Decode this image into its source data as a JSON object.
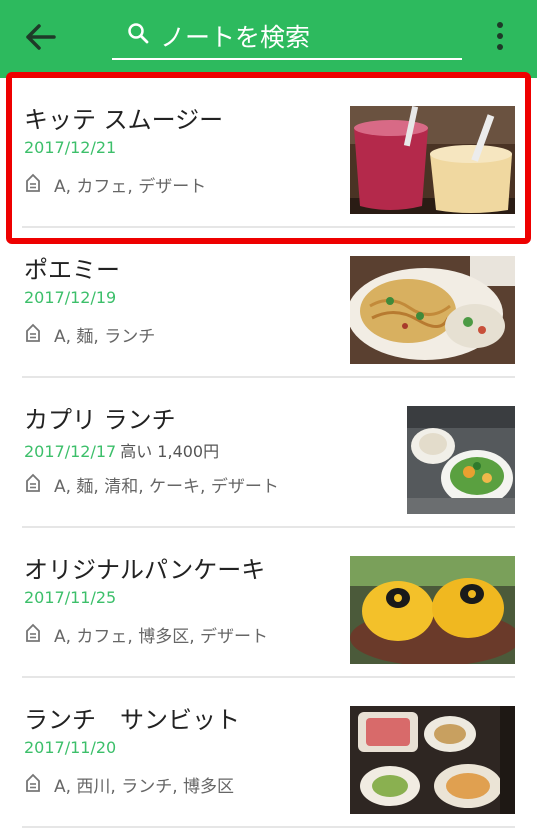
{
  "appbar": {
    "back_icon": "arrow-left-icon",
    "search": {
      "icon": "search-icon",
      "placeholder": "ノートを検索"
    },
    "more_icon": "more-vertical-icon"
  },
  "notes": [
    {
      "title": "キッテ スムージー",
      "date": "2017/12/21",
      "extra": "",
      "tags": "A, カフェ, デザート",
      "tag_icon": "tag-icon",
      "thumbnail": "smoothie-photo"
    },
    {
      "title": "ポエミー",
      "date": "2017/12/19",
      "extra": "",
      "tags": "A, 麺, ランチ",
      "tag_icon": "tag-icon",
      "thumbnail": "pasta-photo"
    },
    {
      "title": "カプリ ランチ",
      "date": "2017/12/17",
      "extra": "高い 1,400円",
      "tags": "A, 麺, 清和, ケーキ, デザート",
      "tag_icon": "tag-icon",
      "thumbnail": "lunch-salad-photo"
    },
    {
      "title": "オリジナルパンケーキ",
      "date": "2017/11/25",
      "extra": "",
      "tags": "A, カフェ, 博多区, デザート",
      "tag_icon": "tag-icon",
      "thumbnail": "pancake-photo"
    },
    {
      "title": "ランチ　サンビット",
      "date": "2017/11/20",
      "extra": "",
      "tags": "A, 西川, ランチ, 博多区",
      "tag_icon": "tag-icon",
      "thumbnail": "sashimi-lunch-photo"
    }
  ],
  "colors": {
    "appbar": "#2dba5e",
    "date_text": "#3cbf6a",
    "highlight": "#ee0000"
  }
}
